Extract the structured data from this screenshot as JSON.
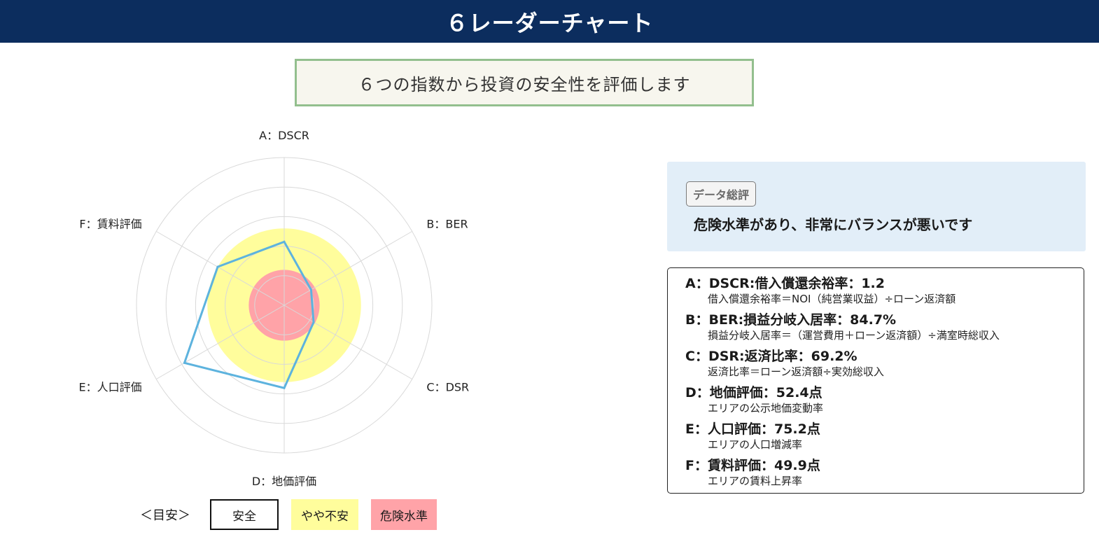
{
  "header": {
    "title": "６レーダーチャート"
  },
  "subtitle": "６つの指数から投資の安全性を評価します",
  "chart_data": {
    "type": "radar",
    "axes": [
      "A：DSCR",
      "B：BER",
      "C：DSR",
      "D：地価評価",
      "E：人口評価",
      "F：賃料評価"
    ],
    "values": [
      43,
      21,
      23,
      56,
      78,
      52
    ],
    "rmax": 100,
    "ring_count": 5,
    "grid": true,
    "zones": [
      {
        "name": "危険水準",
        "max": 24,
        "color": "#ffa3a8"
      },
      {
        "name": "やや不安",
        "max": 52,
        "color": "#fffd9c"
      }
    ],
    "series_color": "#5db3de",
    "grid_color": "#d9d9d9"
  },
  "legend": {
    "title": "＜目安＞",
    "items": [
      {
        "label": "安全",
        "color": "#ffffff"
      },
      {
        "label": "やや不安",
        "color": "#fffd9c"
      },
      {
        "label": "危険水準",
        "color": "#ffa3a8"
      }
    ]
  },
  "summary": {
    "badge": "データ総評",
    "text": "危険水準があり、非常にバランスが悪いです"
  },
  "metrics": [
    {
      "title": "A：DSCR:借入償還余裕率：1.2",
      "desc": "借入償還余裕率＝NOI（純営業収益）÷ローン返済額"
    },
    {
      "title": "B：BER:損益分岐入居率：84.7%",
      "desc": "損益分岐入居率＝（運営費用＋ローン返済額）÷満室時総収入"
    },
    {
      "title": "C：DSR:返済比率：69.2%",
      "desc": "返済比率＝ローン返済額÷実効総収入"
    },
    {
      "title": "D：地価評価：52.4点",
      "desc": "エリアの公示地価変動率"
    },
    {
      "title": "E：人口評価：75.2点",
      "desc": "エリアの人口増減率"
    },
    {
      "title": "F：賃料評価：49.9点",
      "desc": "エリアの賃料上昇率"
    }
  ]
}
